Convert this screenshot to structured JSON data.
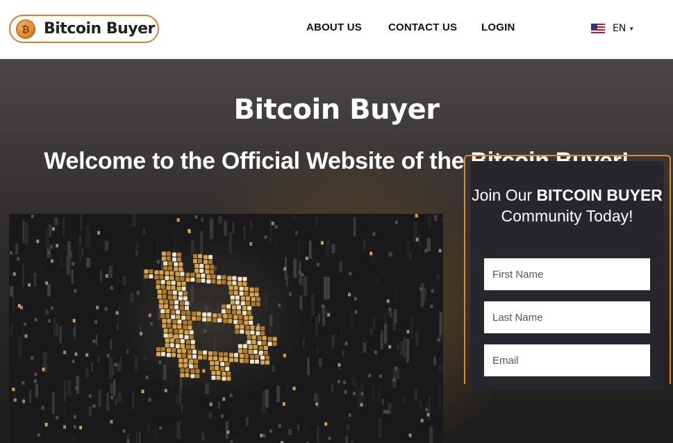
{
  "header": {
    "logo_text": "Bitcoin Buyer",
    "logo_coin_symbol": "₿",
    "nav": {
      "about": "ABOUT US",
      "contact": "CONTACT US",
      "login": "LOGIN"
    },
    "language": "EN"
  },
  "hero": {
    "title": "Bitcoin Buyer",
    "subtitle": "Welcome to the Official Website of the Bitcoin Buyer!"
  },
  "form": {
    "heading_pre": "Join Our ",
    "heading_bold": "BITCOIN BUYER",
    "heading_post": " Community Today!",
    "first_name_placeholder": "First Name",
    "last_name_placeholder": "Last Name",
    "email_placeholder": "Email"
  },
  "colors": {
    "accent": "#e08a2a",
    "card_bg": "#26272c"
  }
}
